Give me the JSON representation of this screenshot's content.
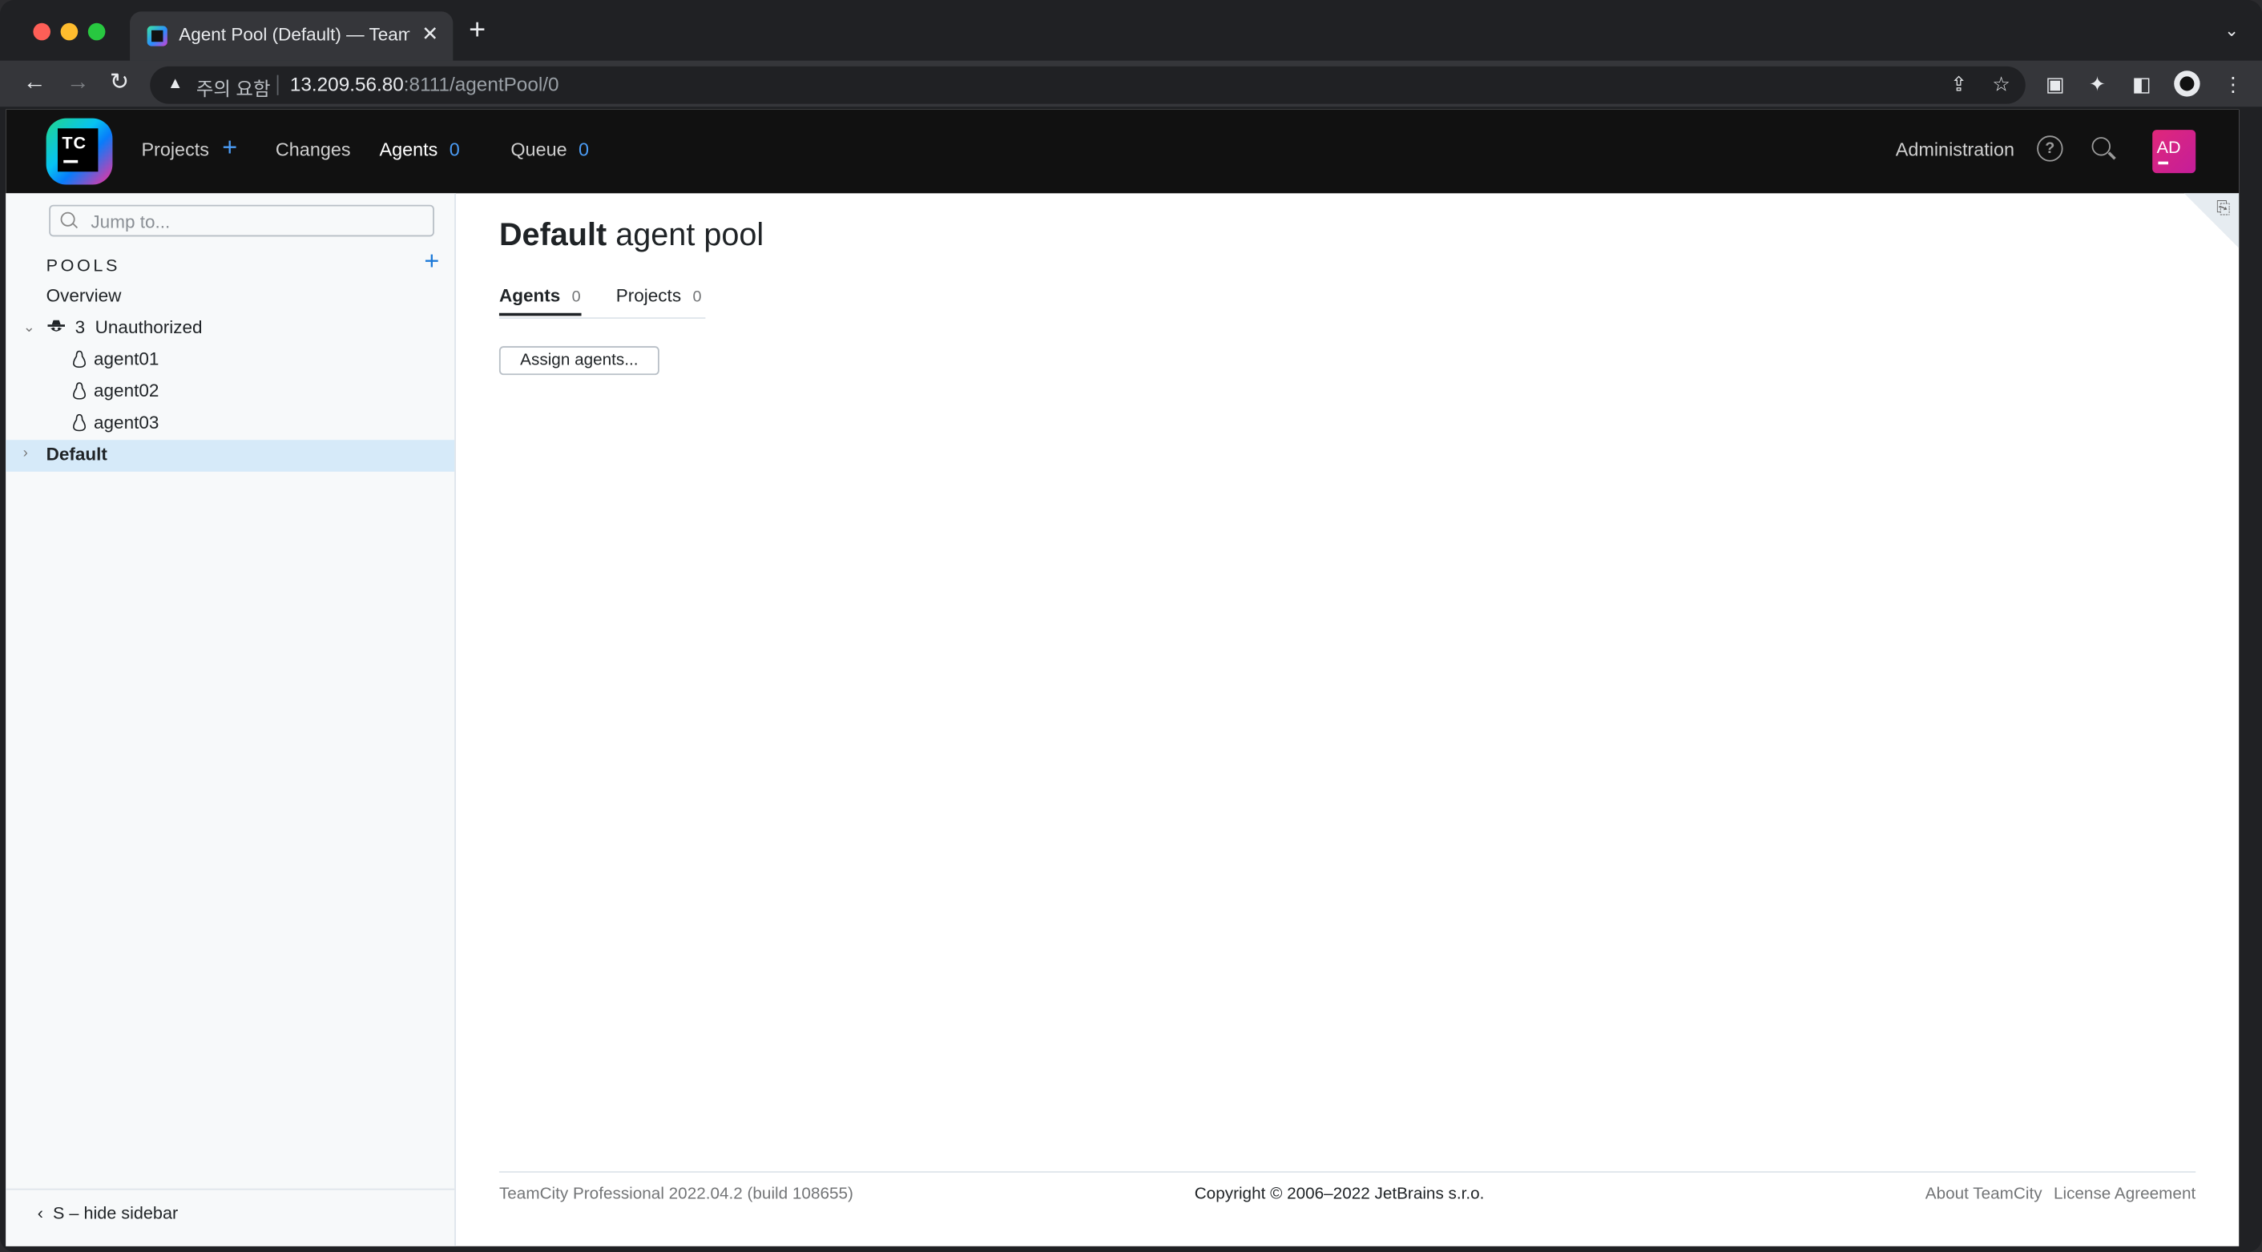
{
  "browser": {
    "tab_title": "Agent Pool (Default) — TeamCity",
    "security_warning": "주의 요함",
    "url_host": "13.209.56.80",
    "url_path": ":8111/agentPool/0"
  },
  "header": {
    "logo_text": "TC",
    "nav": {
      "projects": "Projects",
      "changes": "Changes",
      "agents": "Agents",
      "agents_count": "0",
      "queue": "Queue",
      "queue_count": "0"
    },
    "administration": "Administration",
    "avatar": "AD",
    "help_glyph": "?"
  },
  "sidebar": {
    "jump_placeholder": "Jump to...",
    "pools_title": "POOLS",
    "overview": "Overview",
    "unauthorized_count": "3",
    "unauthorized_label": "Unauthorized",
    "agents": [
      "agent01",
      "agent02",
      "agent03"
    ],
    "default_pool": "Default",
    "hide_sidebar": "S – hide sidebar"
  },
  "main": {
    "title_bold": "Default",
    "title_rest": "agent pool",
    "tabs": [
      {
        "label": "Agents",
        "count": "0"
      },
      {
        "label": "Projects",
        "count": "0"
      }
    ],
    "assign_button": "Assign agents..."
  },
  "footer": {
    "version": "TeamCity Professional 2022.04.2 (build 108655)",
    "copyright": "Copyright © 2006–2022 JetBrains s.r.o.",
    "about": "About TeamCity",
    "license": "License Agreement"
  }
}
